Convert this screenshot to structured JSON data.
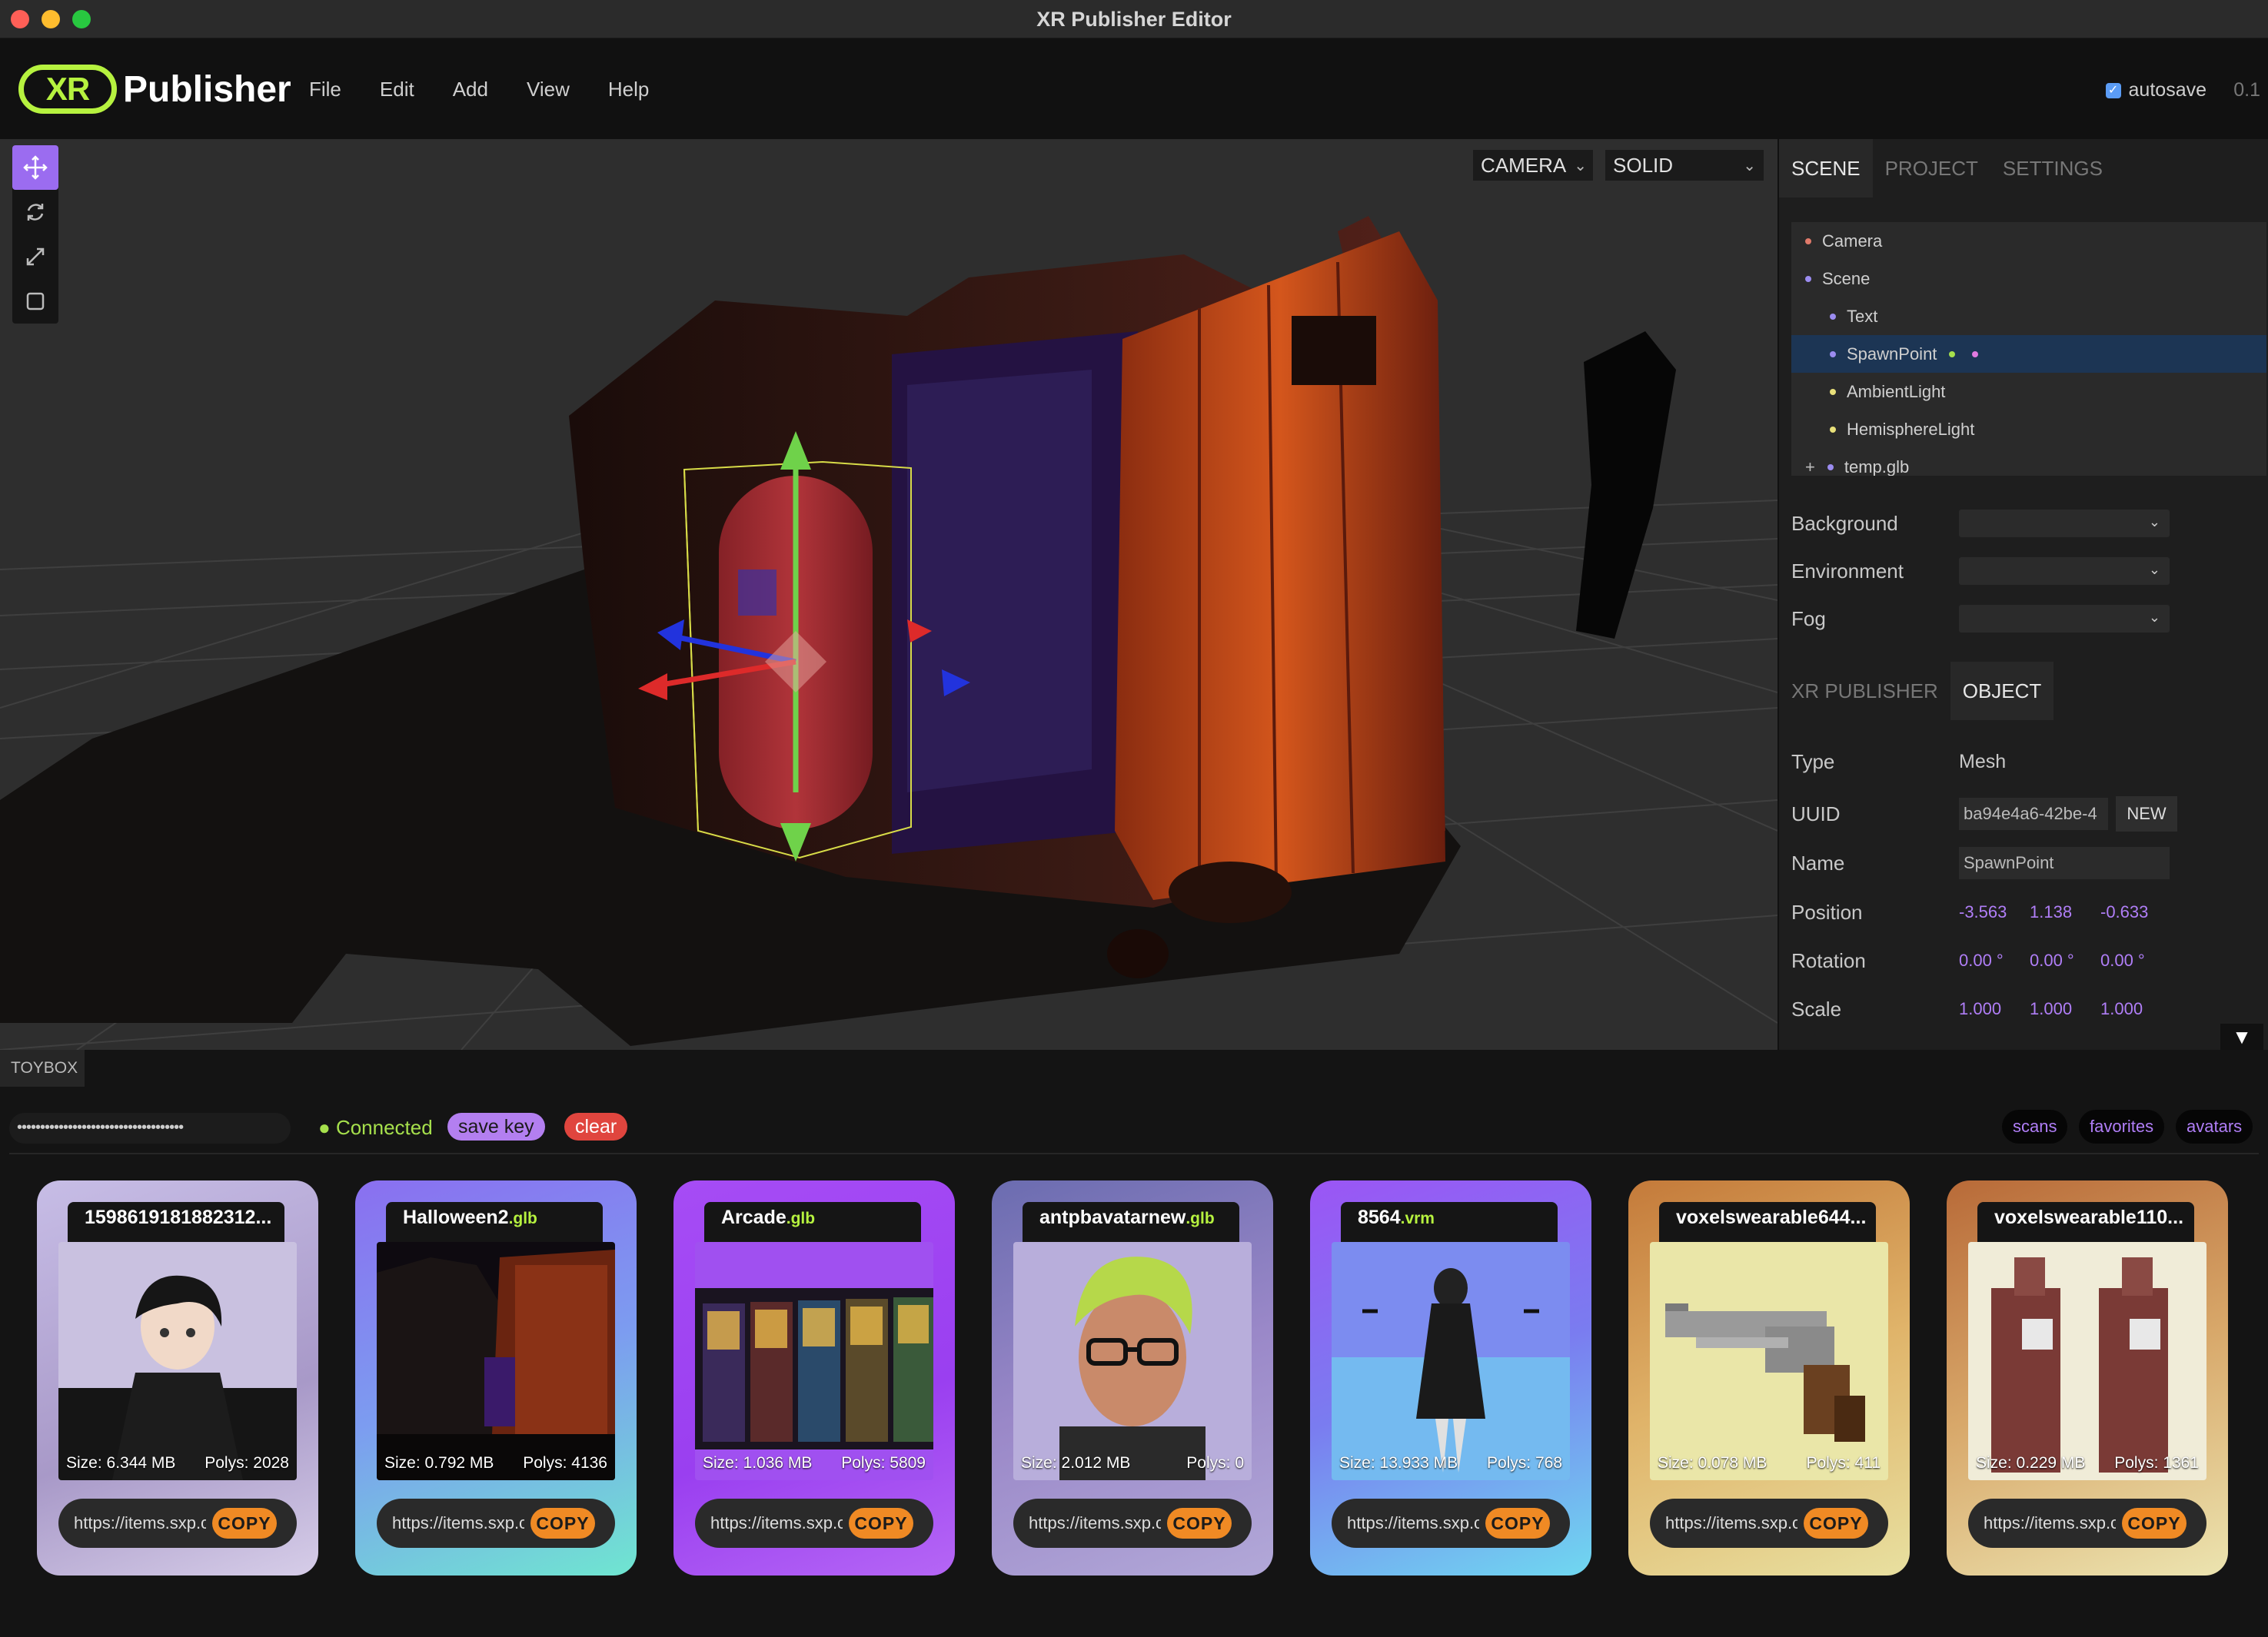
{
  "window": {
    "title": "XR Publisher Editor"
  },
  "app": {
    "logo_mark": "XR",
    "logo_text": "Publisher",
    "menu": [
      "File",
      "Edit",
      "Add",
      "View",
      "Help"
    ],
    "autosave_label": "autosave",
    "autosave_checked": true,
    "version": "0.1"
  },
  "viewport": {
    "camera_select": "CAMERA",
    "shading_select": "SOLID",
    "tools": [
      "move-icon",
      "rotate-icon",
      "scale-icon",
      "square-icon"
    ],
    "active_tool": "move-icon"
  },
  "sidebar": {
    "tabs": [
      "SCENE",
      "PROJECT",
      "SETTINGS"
    ],
    "active_tab": "SCENE",
    "outliner": [
      {
        "label": "Camera",
        "dot": "#e07a6a"
      },
      {
        "label": "Scene",
        "dot": "#9b8cf0"
      },
      {
        "label": "Text",
        "dot": "#9b8cf0"
      },
      {
        "label": "SpawnPoint",
        "dot": "#9b8cf0",
        "selected": true,
        "extra_dots": [
          "#a6e04c",
          "#e07ae0"
        ]
      },
      {
        "label": "AmbientLight",
        "dot": "#e8e07a"
      },
      {
        "label": "HemisphereLight",
        "dot": "#e8e07a"
      },
      {
        "label": "temp.glb",
        "dot": "#9b8cf0",
        "prefix": "+"
      }
    ],
    "scene_props": [
      {
        "label": "Background",
        "value": ""
      },
      {
        "label": "Environment",
        "value": ""
      },
      {
        "label": "Fog",
        "value": ""
      }
    ],
    "object_tabs": [
      "XR PUBLISHER",
      "OBJECT"
    ],
    "active_object_tab": "OBJECT",
    "object": {
      "type_label": "Type",
      "type": "Mesh",
      "uuid_label": "UUID",
      "uuid": "ba94e4a6-42be-4",
      "new_button": "NEW",
      "name_label": "Name",
      "name": "SpawnPoint",
      "position_label": "Position",
      "position": [
        "-3.563",
        "1.138",
        "-0.633"
      ],
      "rotation_label": "Rotation",
      "rotation": [
        "0.00 °",
        "0.00 °",
        "0.00 °"
      ],
      "scale_label": "Scale",
      "scale": [
        "1.000",
        "1.000",
        "1.000"
      ]
    }
  },
  "toybox": {
    "tab_label": "TOYBOX",
    "key_value": "••••••••••••••••••••••••••••••••••••",
    "status": "Connected",
    "save_key": "save key",
    "clear": "clear",
    "filters": [
      "scans",
      "favorites",
      "avatars"
    ],
    "cards": [
      {
        "name": "1598619181882312...",
        "ext": "",
        "size": "Size: 6.344 MB",
        "polys": "Polys: 2028",
        "url": "https://items.sxp.c",
        "copy": "COPY",
        "bg": "linear-gradient(160deg,#c7bde6,#a899c8 60%,#d6cde8)"
      },
      {
        "name": "Halloween2",
        "ext": ".glb",
        "size": "Size: 0.792 MB",
        "polys": "Polys: 4136",
        "url": "https://items.sxp.c",
        "copy": "COPY",
        "bg": "linear-gradient(160deg,#8a6ff0,#7c9cf0 50%,#6fe6d0)"
      },
      {
        "name": "Arcade",
        "ext": ".glb",
        "size": "Size: 1.036 MB",
        "polys": "Polys: 5809",
        "url": "https://items.sxp.c",
        "copy": "COPY",
        "bg": "linear-gradient(160deg,#a64cf5,#9a3ff0 60%,#b566f5)"
      },
      {
        "name": "antpbavatarnew",
        "ext": ".glb",
        "size": "Size: 2.012 MB",
        "polys": "Polys: 0",
        "url": "https://items.sxp.c",
        "copy": "COPY",
        "bg": "linear-gradient(160deg,#6b6cb0,#9a88c8 50%,#b2a8d8)"
      },
      {
        "name": "8564",
        "ext": ".vrm",
        "size": "Size: 13.933 MB",
        "polys": "Polys: 768",
        "url": "https://items.sxp.c",
        "copy": "COPY",
        "bg": "linear-gradient(160deg,#9b55f5,#7a7cf0 50%,#6fd8f0)"
      },
      {
        "name": "voxelswearable644...",
        "ext": "",
        "size": "Size: 0.078 MB",
        "polys": "Polys: 411",
        "url": "https://items.sxp.c",
        "copy": "COPY",
        "bg": "linear-gradient(160deg,#c47a3a,#e0b46a 50%,#e8e0a0)"
      },
      {
        "name": "voxelswearable110...",
        "ext": "",
        "size": "Size: 0.229 MB",
        "polys": "Polys: 1361",
        "url": "https://items.sxp.c",
        "copy": "COPY",
        "bg": "linear-gradient(160deg,#b86a38,#d8a86a 50%,#ece4b0)"
      }
    ]
  }
}
